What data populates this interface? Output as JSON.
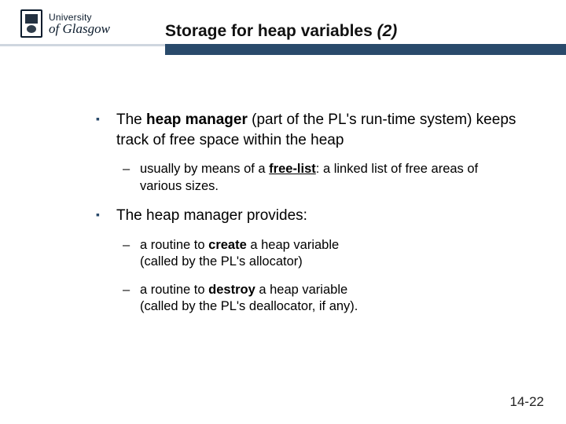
{
  "logo": {
    "line1": "University",
    "line2": "of Glasgow"
  },
  "title": {
    "main": "Storage for heap variables ",
    "italic": "(2)"
  },
  "bullets": {
    "b1": {
      "pre": "The ",
      "bold": "heap manager",
      "post": " (part of the PL's run-time system) keeps track of free space within the heap",
      "sub1": {
        "pre": "usually by means of a ",
        "bold": "free-list",
        "post": ": a linked list of free areas of various sizes."
      }
    },
    "b2": {
      "text": "The heap manager provides:",
      "sub1": {
        "pre": "a routine to ",
        "bold": "create",
        "post": " a heap variable",
        "line2": "(called by the PL's allocator)"
      },
      "sub2": {
        "pre": "a routine to ",
        "bold": "destroy",
        "post": " a heap variable",
        "line2": "(called by the PL's deallocator, if any)."
      }
    }
  },
  "pagenum": "14-22"
}
